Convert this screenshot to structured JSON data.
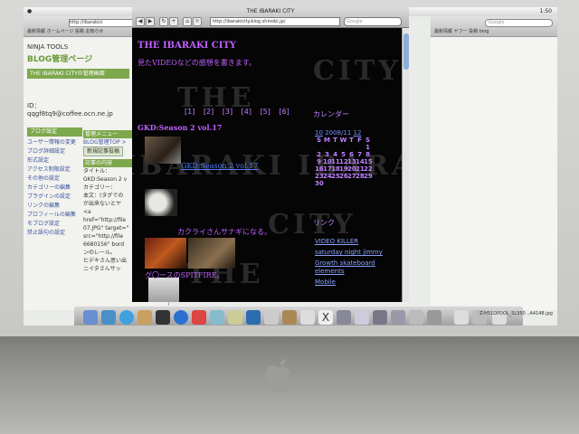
{
  "menubar": {
    "time": "1:50"
  },
  "back_window": {
    "url": "http://ibarakici",
    "bookmarks": "最新情報 ホームページ 投稿 お知らせ",
    "ninja": "NINJA TOOLS",
    "blog_title": "BLOG管理ページ",
    "blog_kana": "ニンジャブログ",
    "section_title": "THE IBARAKI CITYの管理画面",
    "id_label": "ID：",
    "id_value": "qqgf8tq9@coffee.ocn.ne.jp",
    "sidebar_header": "ブログ設定",
    "sidebar_items": [
      "ユーザー情報の変更",
      "ブログ詳細設定",
      "形式設定",
      "アクセス制限設定",
      "その他の設定",
      "カテゴリーの編集",
      "プラグインの設定",
      "リンクの編集",
      "プロフィールの編集",
      "モブログ設定",
      "禁止語句の設定"
    ],
    "col2_header": "管理メニュー",
    "col2_crumb": "BLOG管理TOP >",
    "col2_tab": "新規記事投稿",
    "col2_section": "記事の内容",
    "col2_lines": [
      "タイトル：",
      "GKD:Season 2 v",
      "カテゴリー：",
      "本文：(タグでの",
      "が出来ないとヤ",
      "<a",
      "href=\"http://file",
      "07.JPG\" target=\"",
      "src=\"http://file",
      "6680156\" bord",
      "ンのレール。",
      "ヒデキさん思い出",
      "ニイタさんサッ"
    ]
  },
  "right_window": {
    "search_placeholder": "Google",
    "bookmarks": "最新情報 ヤフー 投稿 blog"
  },
  "main_window": {
    "title": "THE IBARAKI CITY",
    "url": "http://ibarakicity.blog.shinobi.jp/",
    "search_placeholder": "Google",
    "bookmarks": "あそびあそびホームページ 最新記事 投稿 welcome to domain 投稿 BLACK LABEL ISTABIBARS"
  },
  "page": {
    "watermark": "CITY",
    "watermark2": "THE",
    "watermark3": "IBARAKI IBARAKI",
    "title": "THE IBARAKI CITY",
    "subtitle": "見たVIDEOなどの感想を書きます。",
    "pager": [
      "[1]",
      "[2]",
      "[3]",
      "[4]",
      "[5]",
      "[6]"
    ],
    "post1_title": "GKD:Season 2 vol.17",
    "post1_link": "GKD:Season 2 vol.17",
    "post2_caption": "カクライさんサナギになる。",
    "post3_caption": "グ〇ースのSPITFIRE。",
    "calendar_heading": "カレンダー",
    "cal_prev": "10",
    "cal_month": "2008/11",
    "cal_next": "12",
    "weekdays": [
      "S",
      "M",
      "T",
      "W",
      "T",
      "F",
      "S"
    ],
    "weeks": [
      [
        "",
        "",
        "",
        "",
        "",
        "",
        "1"
      ],
      [
        "2",
        "3",
        "4",
        "5",
        "6",
        "7",
        "8"
      ],
      [
        "9",
        "10",
        "11",
        "12",
        "13",
        "14",
        "15"
      ],
      [
        "16",
        "17",
        "18",
        "19",
        "20",
        "21",
        "22"
      ],
      [
        "23",
        "24",
        "25",
        "26",
        "27",
        "28",
        "29"
      ],
      [
        "30",
        "",
        "",
        "",
        "",
        "",
        ""
      ]
    ],
    "links_heading": "リンク",
    "links": [
      "VIDEO KILLER",
      "saturday night jimmy",
      "Growth skateboard elements",
      "Mobile"
    ]
  },
  "dock_right": "Z-H51DPDOL_SL350 ..A4148.jpg"
}
